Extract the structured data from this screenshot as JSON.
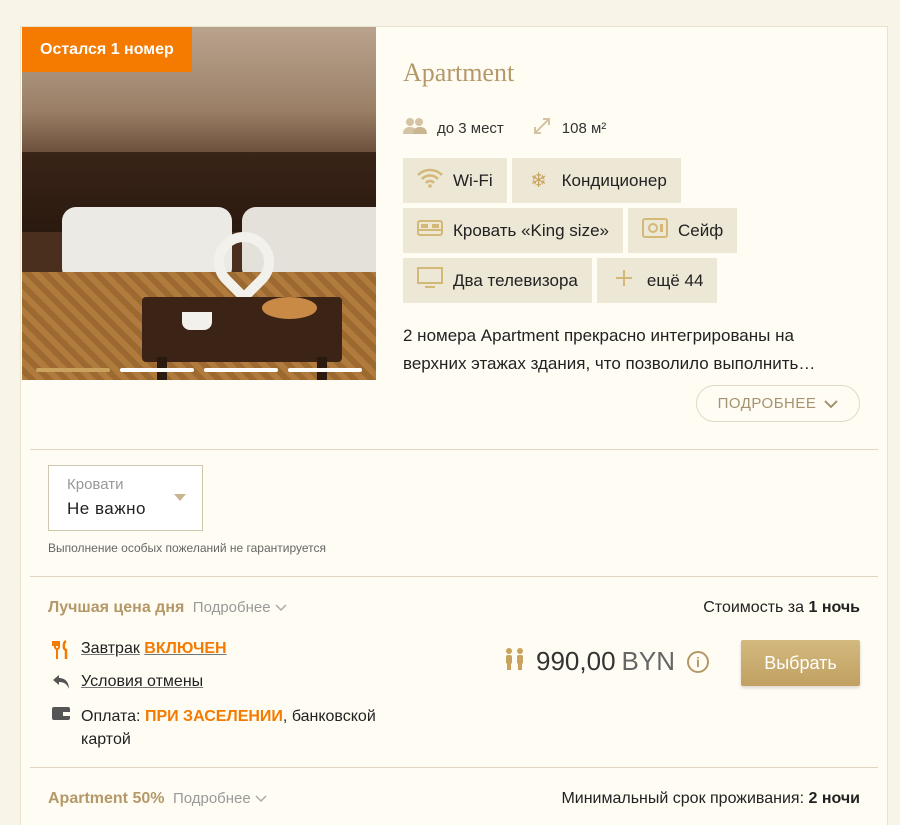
{
  "badge": "Остался 1 номер",
  "room": {
    "title": "Apartment",
    "capacity": "до 3 мест",
    "area": "108 м²",
    "amenities": [
      {
        "label": "Wi-Fi",
        "icon": "wifi-icon"
      },
      {
        "label": "Кондиционер",
        "icon": "snowflake-icon"
      },
      {
        "label": "Кровать «King size»",
        "icon": "bed-icon"
      },
      {
        "label": "Сейф",
        "icon": "safe-icon"
      },
      {
        "label": "Два телевизора",
        "icon": "tv-icon"
      },
      {
        "label": "ещё 44",
        "icon": "plus-icon"
      }
    ],
    "description_line1": "2 номера Apartment прекрасно интегрированы на",
    "description_line2": "верхних этажах здания, что позволило выполнить…",
    "more_label": "ПОДРОБНЕЕ"
  },
  "beds": {
    "label": "Кровати",
    "value": "Не важно",
    "note": "Выполнение особых пожеланий не гарантируется"
  },
  "rate1": {
    "name": "Лучшая цена дня",
    "more": "Подробнее",
    "cost_prefix": "Стоимость за",
    "cost_nights": "1 ночь",
    "breakfast_label": "Завтрак",
    "breakfast_status": "ВКЛЮЧЕН",
    "cancel_label": "Условия отмены",
    "payment_label": "Оплата:",
    "payment_when": "ПРИ ЗАСЕЛЕНИИ",
    "payment_rest": ", банковской",
    "payment_rest2": "картой",
    "price": "990,00",
    "currency": "BYN",
    "select_label": "Выбрать"
  },
  "rate2": {
    "name": "Apartment 50%",
    "more": "Подробнее",
    "min_stay_prefix": "Минимальный срок проживания:",
    "min_stay_value": "2 ночи"
  },
  "colors": {
    "accent_orange": "#f47a00",
    "gold": "#b4986a",
    "button_gold": "#c9a35d"
  }
}
